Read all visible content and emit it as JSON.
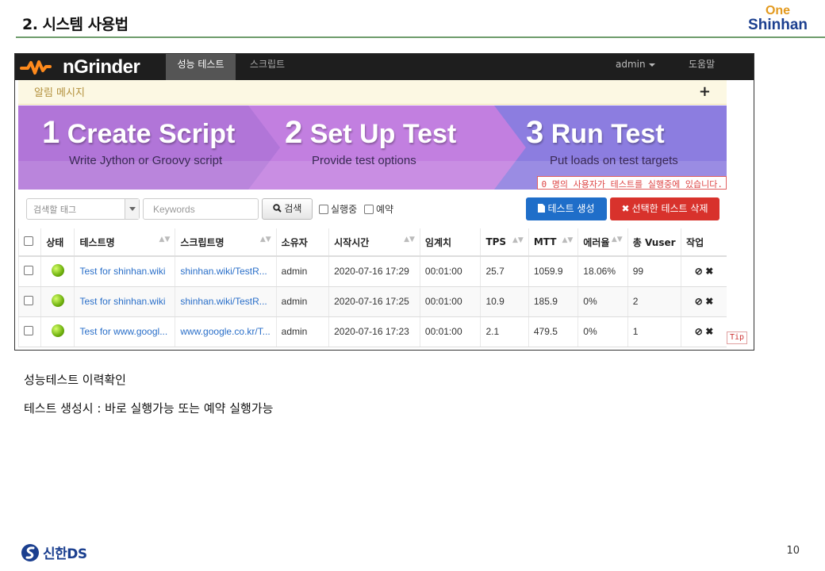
{
  "slide": {
    "title": "2. 시스템 사용법",
    "brand_one": "One",
    "brand_name": "Shinhan",
    "notes": [
      "성능테스트 이력확인",
      "테스트 생성시 : 바로 실행가능 또는 예약 실행가능"
    ],
    "footer_brand": "신한DS",
    "page_number": "10"
  },
  "navbar": {
    "logo": "nGrinder",
    "tabs": [
      {
        "label": "성능 테스트",
        "active": true
      },
      {
        "label": "스크립트",
        "active": false
      }
    ],
    "user": "admin",
    "help": "도움말"
  },
  "alert": {
    "text": "알림 메시지",
    "plus": "+"
  },
  "banner": {
    "steps": [
      {
        "num": "1",
        "title": "Create Script",
        "subtitle": "Write Jython or Groovy script"
      },
      {
        "num": "2",
        "title": "Set Up Test",
        "subtitle": "Provide test options"
      },
      {
        "num": "3",
        "title": "Run Test",
        "subtitle": "Put loads on test targets"
      }
    ],
    "running_note": "0 명의 사용자가 테스트를 실행중에 있습니다."
  },
  "filters": {
    "tag_placeholder": "검색할 태그",
    "keywords_placeholder": "Keywords",
    "search_label": "검색",
    "running_label": "실행중",
    "scheduled_label": "예약",
    "create_label": "테스트 생성",
    "delete_label": "선택한 테스트 삭제"
  },
  "table": {
    "headers": [
      "상태",
      "테스트명",
      "스크립트명",
      "소유자",
      "시작시간",
      "임계치",
      "TPS",
      "MTT",
      "에러율",
      "총 Vuser",
      "작업"
    ],
    "rows": [
      {
        "name": "Test for shinhan.wiki",
        "script": "shinhan.wiki/TestR...",
        "owner": "admin",
        "start": "2020-07-16 17:29",
        "threshold": "00:01:00",
        "tps": "25.7",
        "mtt": "1059.9",
        "error": "18.06%",
        "vuser": "99"
      },
      {
        "name": "Test for shinhan.wiki",
        "script": "shinhan.wiki/TestR...",
        "owner": "admin",
        "start": "2020-07-16 17:25",
        "threshold": "00:01:00",
        "tps": "10.9",
        "mtt": "185.9",
        "error": "0%",
        "vuser": "2"
      },
      {
        "name": "Test for www.googl...",
        "script": "www.google.co.kr/T...",
        "owner": "admin",
        "start": "2020-07-16 17:23",
        "threshold": "00:01:00",
        "tps": "2.1",
        "mtt": "479.5",
        "error": "0%",
        "vuser": "1"
      }
    ],
    "tip": "Tip"
  }
}
